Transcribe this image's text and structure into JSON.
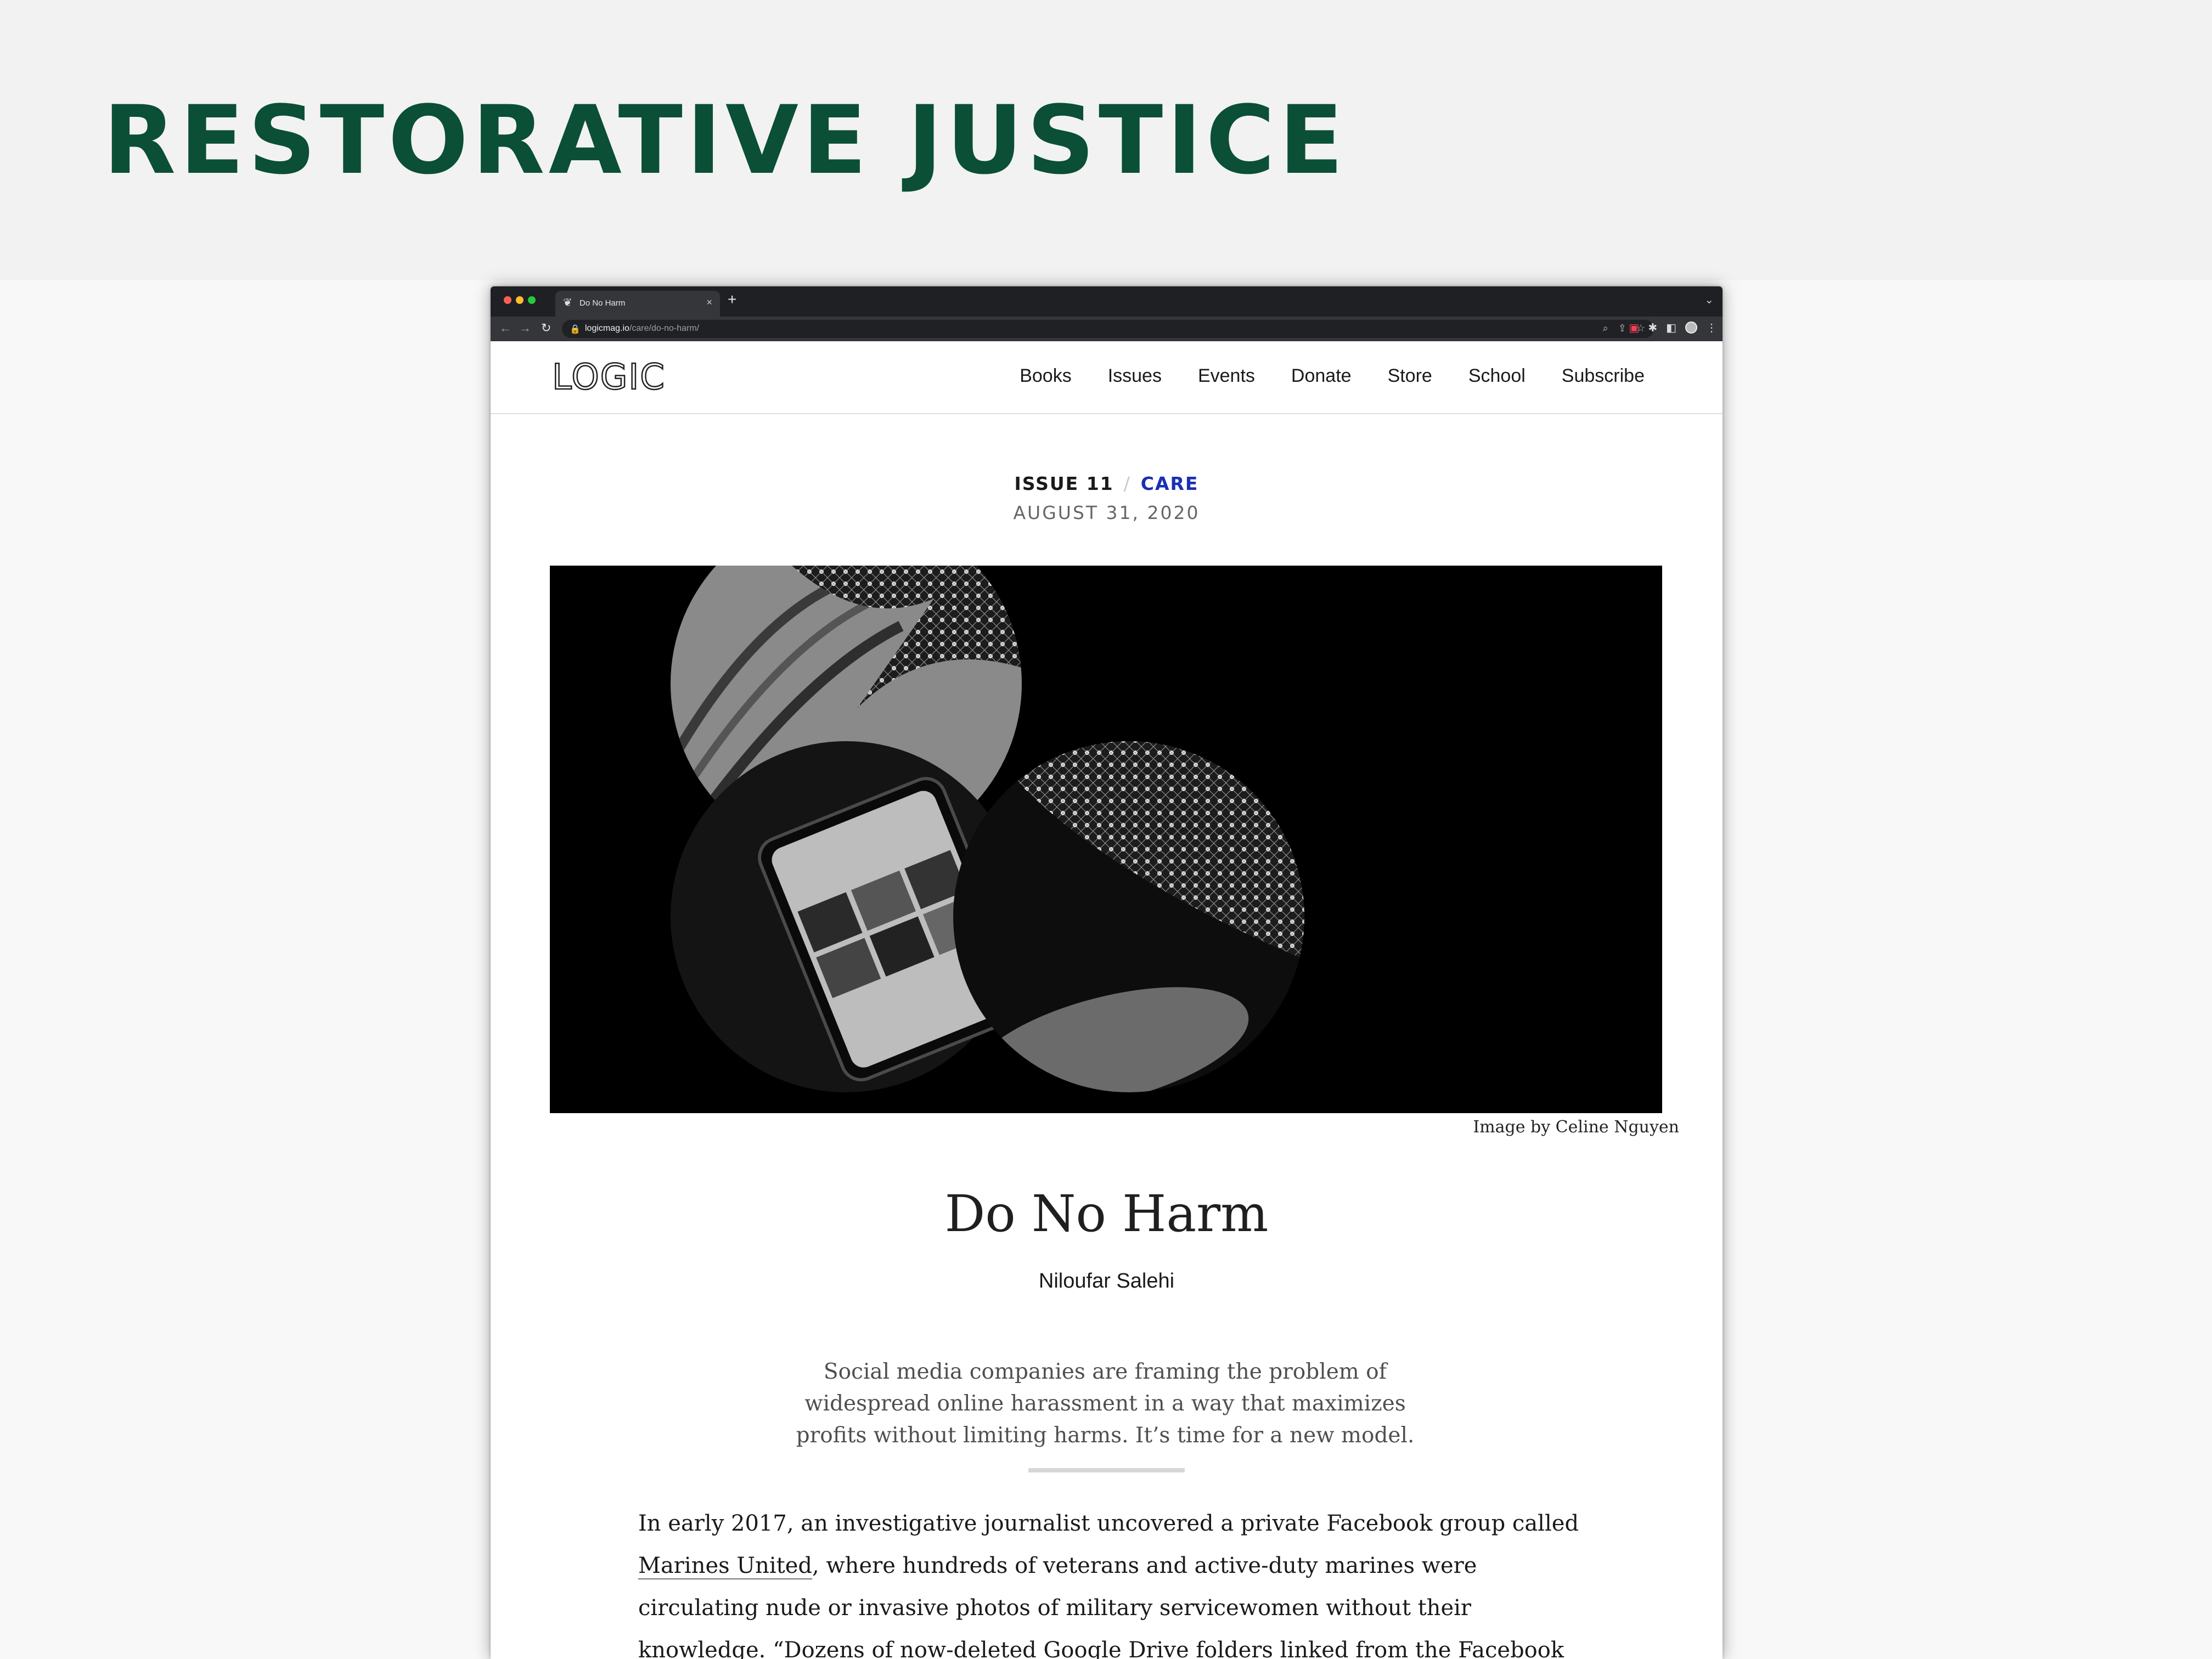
{
  "slide": {
    "title": "RESTORATIVE JUSTICE",
    "title_color": "#0a4f36"
  },
  "browser": {
    "tab_title": "Do No Harm",
    "tab_close": "×",
    "new_tab": "+",
    "url_host": "logicmag.io",
    "url_path": "/care/do-no-harm/"
  },
  "site": {
    "logo": "LOGIC",
    "nav": [
      "Books",
      "Issues",
      "Events",
      "Donate",
      "Store",
      "School",
      "Subscribe"
    ]
  },
  "article": {
    "issue": "ISSUE 11",
    "separator": "/",
    "category": "CARE",
    "category_color": "#1a2fb5",
    "date": "AUGUST 31, 2020",
    "caption": "Image by Celine Nguyen",
    "title": "Do No Harm",
    "author": "Niloufar Salehi",
    "dek_lines": [
      "Social media companies are framing the problem of",
      "widespread online harassment in a way that maximizes",
      "profits without limiting harms. It’s time for a new model."
    ],
    "body": {
      "before_link": "In early 2017, an investigative journalist uncovered a private Facebook group called ",
      "link": "Marines United",
      "after_link": ", where hundreds of veterans and active-duty marines were circulating nude or invasive photos of military servicewomen without their knowledge. “Dozens of now-deleted Google Drive folders linked from the Facebook page included dossiers of"
    }
  }
}
